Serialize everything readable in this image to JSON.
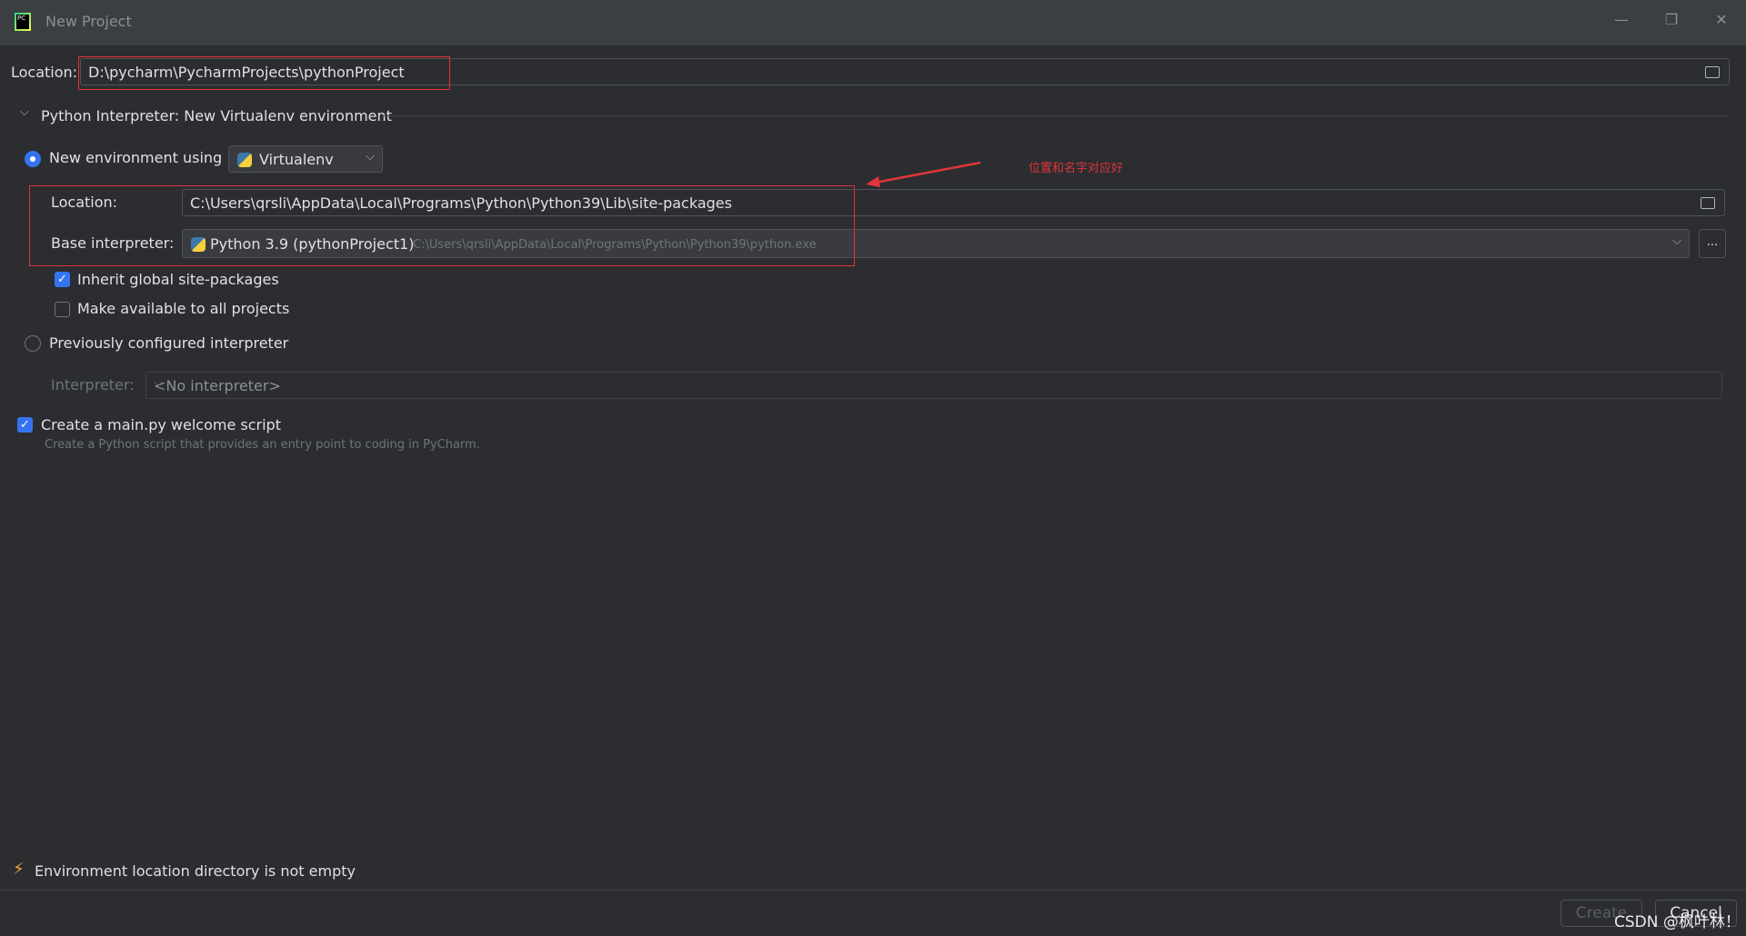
{
  "window": {
    "title": "New Project",
    "minimize": "—",
    "restore": "❐",
    "close": "✕"
  },
  "project_location": {
    "label": "Location:",
    "value": "D:\\pycharm\\PycharmProjects\\pythonProject"
  },
  "section": {
    "title": "Python Interpreter: New Virtualenv environment"
  },
  "new_env": {
    "label": "New environment using",
    "tool": "Virtualenv",
    "location_label": "Location:",
    "location_value": "C:\\Users\\qrsli\\AppData\\Local\\Programs\\Python\\Python39\\Lib\\site-packages",
    "base_label": "Base interpreter:",
    "base_name": "Python 3.9 (pythonProject1)",
    "base_path": "C:\\Users\\qrsli\\AppData\\Local\\Programs\\Python\\Python39\\python.exe",
    "more": "...",
    "inherit_label": "Inherit global site-packages",
    "inherit_checked": true,
    "available_label": "Make available to all projects",
    "available_checked": false
  },
  "previous": {
    "label": "Previously configured interpreter",
    "interpreter_label": "Interpreter:",
    "interpreter_value": "<No interpreter>"
  },
  "welcome": {
    "label": "Create a main.py welcome script",
    "checked": true,
    "description": "Create a Python script that provides an entry point to coding in PyCharm."
  },
  "annotation": {
    "text": "位置和名字对应好",
    "color": "#e0353a"
  },
  "warning": {
    "text": "Environment location directory is not empty"
  },
  "buttons": {
    "create": "Create",
    "cancel": "Cancel"
  },
  "watermark": "CSDN @枫叶林！"
}
